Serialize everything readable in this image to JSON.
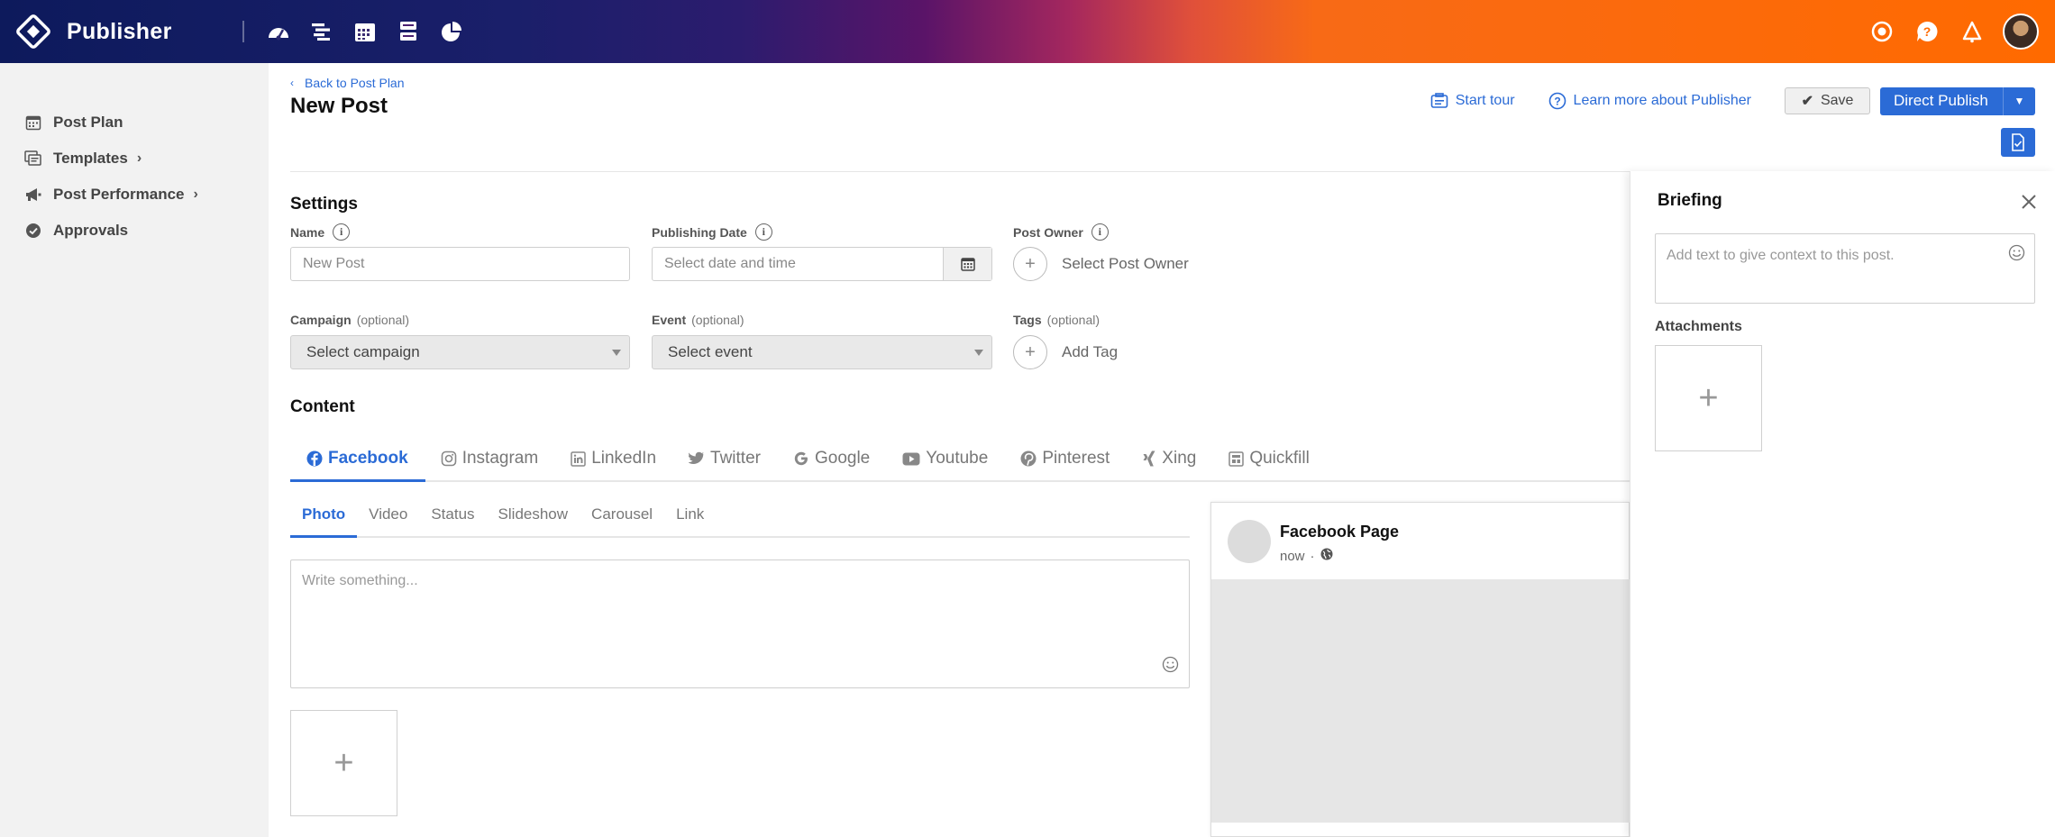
{
  "app": {
    "name": "Publisher"
  },
  "sidebar": {
    "items": [
      {
        "label": "Post Plan",
        "icon": "calendar-icon"
      },
      {
        "label": "Templates",
        "icon": "templates-icon"
      },
      {
        "label": "Post Performance",
        "icon": "megaphone-icon"
      },
      {
        "label": "Approvals",
        "icon": "check-circle-icon"
      }
    ]
  },
  "header": {
    "back_link": "Back to Post Plan",
    "title": "New Post",
    "start_tour": "Start tour",
    "learn_more": "Learn more about Publisher",
    "save": "Save",
    "publish": "Direct Publish"
  },
  "settings": {
    "title": "Settings",
    "name_label": "Name",
    "name_value": "New Post",
    "date_label": "Publishing Date",
    "date_placeholder": "Select date and time",
    "owner_label": "Post Owner",
    "owner_action": "Select Post Owner",
    "campaign_label": "Campaign",
    "campaign_optional": "(optional)",
    "campaign_value": "Select campaign",
    "event_label": "Event",
    "event_optional": "(optional)",
    "event_value": "Select event",
    "tags_label": "Tags",
    "tags_optional": "(optional)",
    "tags_action": "Add Tag"
  },
  "content": {
    "title": "Content",
    "networks": [
      "Facebook",
      "Instagram",
      "LinkedIn",
      "Twitter",
      "Google",
      "Youtube",
      "Pinterest",
      "Xing",
      "Quickfill"
    ],
    "active_network": "Facebook",
    "post_types": [
      "Photo",
      "Video",
      "Status",
      "Slideshow",
      "Carousel",
      "Link"
    ],
    "active_post_type": "Photo",
    "compose_placeholder": "Write something..."
  },
  "preview": {
    "page_name": "Facebook Page",
    "time": "now",
    "separator": "·"
  },
  "briefing": {
    "title": "Briefing",
    "placeholder": "Add text to give context to this post.",
    "attachments_label": "Attachments"
  },
  "colors": {
    "accent": "#2b6bd6",
    "topbar_start": "#0d1a5c",
    "topbar_end": "#ff6a00"
  }
}
